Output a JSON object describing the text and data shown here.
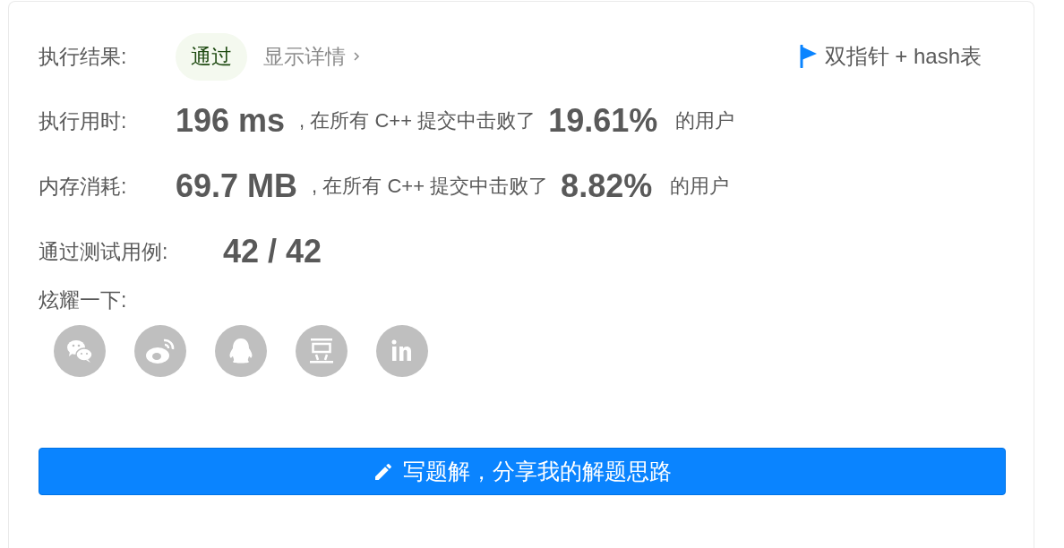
{
  "result": {
    "label": "执行结果:",
    "status": "通过",
    "details_link": "显示详情",
    "tag": "双指针 + hash表"
  },
  "stats": [
    {
      "label": "执行用时:",
      "value": "196 ms",
      "middle": ", 在所有 C++ 提交中击败了",
      "percent": "19.61%",
      "suffix": "的用户"
    },
    {
      "label": "内存消耗:",
      "value": "69.7 MB",
      "middle": ", 在所有 C++ 提交中击败了",
      "percent": "8.82%",
      "suffix": "的用户"
    }
  ],
  "test_cases": {
    "label": "通过测试用例:",
    "value": "42 / 42"
  },
  "share": {
    "label": "炫耀一下:",
    "icons": [
      {
        "kind": "wechat"
      },
      {
        "kind": "weibo"
      },
      {
        "kind": "qq"
      },
      {
        "kind": "douban"
      },
      {
        "kind": "linkedin"
      }
    ]
  },
  "write_button": {
    "label": "写题解，分享我的解题思路"
  }
}
